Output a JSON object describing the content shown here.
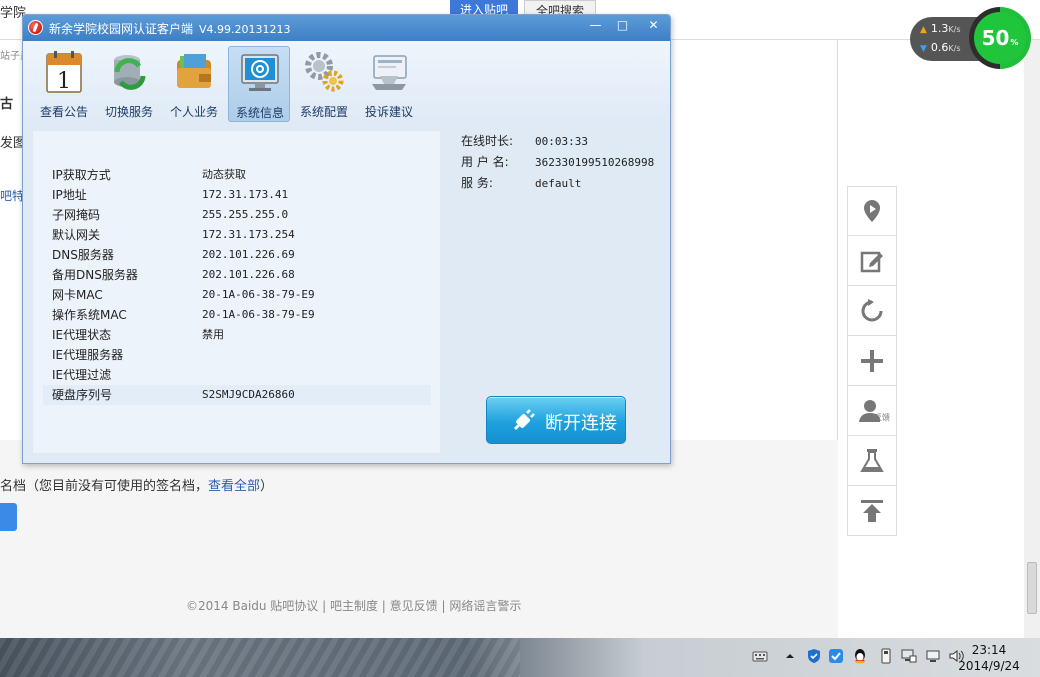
{
  "background": {
    "top_text": "学院",
    "tab_enter": "进入贴吧",
    "tab_search": "全吧搜索",
    "fragments": [
      "站子盖",
      "古",
      "发图",
      "吧特"
    ],
    "sign_text": "名档（您目前没有可使用的签名档，",
    "sign_link": "查看全部",
    "sign_end": "）",
    "footer": "©2014 Baidu 贴吧协议 | 吧主制度 | 意见反馈 | 网络谣言警示",
    "speed_up_value": "1.3",
    "speed_down_value": "0.6",
    "speed_unit": "K/s",
    "cpu_value": "50",
    "cpu_unit": "%",
    "side_tool_small_text": "反馈"
  },
  "client": {
    "title": "新余学院校园网认证客户端",
    "version": "V4.99.20131213",
    "window_controls": {
      "minimize": "—",
      "maximize": "□",
      "close": "✕"
    },
    "toolbar": [
      {
        "label": "查看公告",
        "icon": "calendar-icon"
      },
      {
        "label": "切换服务",
        "icon": "database-sync-icon"
      },
      {
        "label": "个人业务",
        "icon": "wallet-icon"
      },
      {
        "label": "系统信息",
        "icon": "monitor-at-icon",
        "active": true
      },
      {
        "label": "系统配置",
        "icon": "gears-icon"
      },
      {
        "label": "投诉建议",
        "icon": "feedback-icon"
      }
    ],
    "calendar_text": "1",
    "info_rows": [
      {
        "label": "IP获取方式",
        "value": "动态获取"
      },
      {
        "label": "IP地址",
        "value": "172.31.173.41"
      },
      {
        "label": "子网掩码",
        "value": "255.255.255.0"
      },
      {
        "label": "默认网关",
        "value": "172.31.173.254"
      },
      {
        "label": "DNS服务器",
        "value": "202.101.226.69"
      },
      {
        "label": "备用DNS服务器",
        "value": "202.101.226.68"
      },
      {
        "label": "网卡MAC",
        "value": "20-1A-06-38-79-E9"
      },
      {
        "label": "操作系统MAC",
        "value": "20-1A-06-38-79-E9"
      },
      {
        "label": "IE代理状态",
        "value": "禁用"
      },
      {
        "label": "IE代理服务器",
        "value": ""
      },
      {
        "label": "IE代理过滤",
        "value": ""
      },
      {
        "label": "硬盘序列号",
        "value": "S2SMJ9CDA26860"
      }
    ],
    "status": [
      {
        "label": "在线时长:",
        "value": "00:03:33"
      },
      {
        "label": "用 户 名:",
        "value": "362330199510268998"
      },
      {
        "label": "服    务:",
        "value": "default"
      }
    ],
    "disconnect_label": "断开连接"
  },
  "taskbar": {
    "time": "23:14",
    "date": "2014/9/24",
    "tray_icons": [
      "keyboard-icon",
      "show-hidden-icon",
      "shield-icon",
      "security-icon",
      "qq-icon",
      "usb-icon",
      "network-icon",
      "network-adapter-icon",
      "volume-icon"
    ]
  }
}
